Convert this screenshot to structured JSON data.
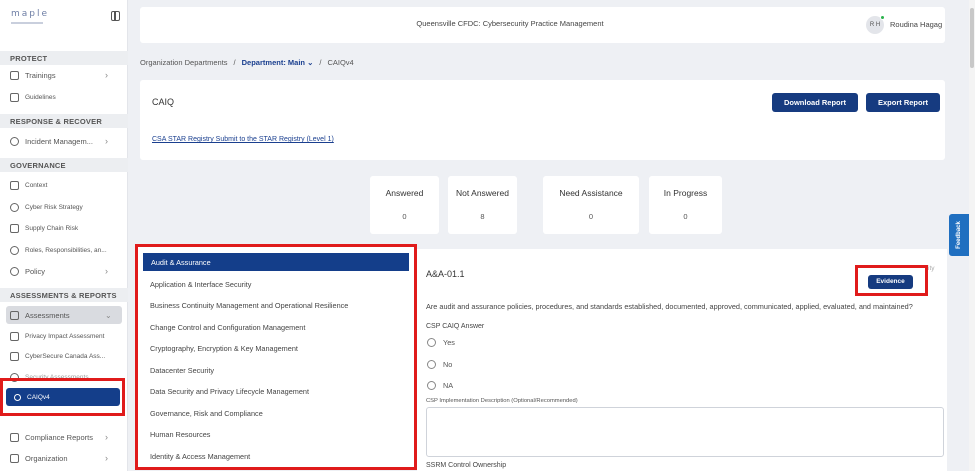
{
  "app": {
    "logo": "maple"
  },
  "sidebar": {
    "sections": [
      {
        "title": "PROTECT",
        "items": [
          {
            "label": "Trainings"
          },
          {
            "label": "Guidelines"
          }
        ]
      },
      {
        "title": "RESPONSE & RECOVER",
        "items": [
          {
            "label": "Incident Managem..."
          }
        ]
      },
      {
        "title": "GOVERNANCE",
        "items": [
          {
            "label": "Context"
          },
          {
            "label": "Cyber Risk Strategy"
          },
          {
            "label": "Supply Chain Risk"
          },
          {
            "label": "Roles, Responsibilities, an..."
          },
          {
            "label": "Policy"
          }
        ]
      },
      {
        "title": "ASSESSMENTS & REPORTS",
        "items": [
          {
            "label": "Assessments"
          },
          {
            "label": "Privacy Impact Assessment"
          },
          {
            "label": "CyberSecure Canada Ass..."
          },
          {
            "label": "Security Assessments"
          },
          {
            "label": "CAIQv4"
          },
          {
            "label": "Compliance Reports"
          },
          {
            "label": "Organization"
          }
        ]
      }
    ]
  },
  "header": {
    "title": "Queensville CFDC: Cybersecurity Practice Management",
    "user_initials": "R H",
    "user_name": "Roudina Hagag"
  },
  "breadcrumb": {
    "root": "Organization Departments",
    "department": "Department: Main",
    "current": "CAIQv4"
  },
  "caiq": {
    "title": "CAIQ",
    "download_label": "Download Report",
    "export_label": "Export Report",
    "star_link": "CSA STAR Registry Submit to the STAR Registry (Level 1)"
  },
  "stats": [
    {
      "label": "Answered",
      "value": "0"
    },
    {
      "label": "Not Answered",
      "value": "8"
    },
    {
      "label": "Need Assistance",
      "value": "0"
    },
    {
      "label": "In Progress",
      "value": "0"
    }
  ],
  "categories": [
    "Audit & Assurance",
    "Application & Interface Security",
    "Business Continuity Management and Operational Resilience",
    "Change Control and Configuration Management",
    "Cryptography, Encryption & Key Management",
    "Datacenter Security",
    "Data Security and Privacy Lifecycle Management",
    "Governance, Risk and Compliance",
    "Human Resources",
    "Identity & Access Management"
  ],
  "question": {
    "id": "A&A-01.1",
    "evidence_label": "Evidence",
    "partial_text": "ity",
    "text": "Are audit and assurance policies, procedures, and standards established, documented, approved, communicated, applied, evaluated, and maintained?",
    "answer_label": "CSP CAIQ Answer",
    "options": [
      "Yes",
      "No",
      "NA"
    ],
    "impl_label": "CSP Implementation Description (Optional/Recommended)",
    "ownership_label": "SSRM Control Ownership"
  },
  "feedback": "Feedback",
  "colors": {
    "primary": "#143e8a",
    "highlight": "#e01b1b"
  }
}
